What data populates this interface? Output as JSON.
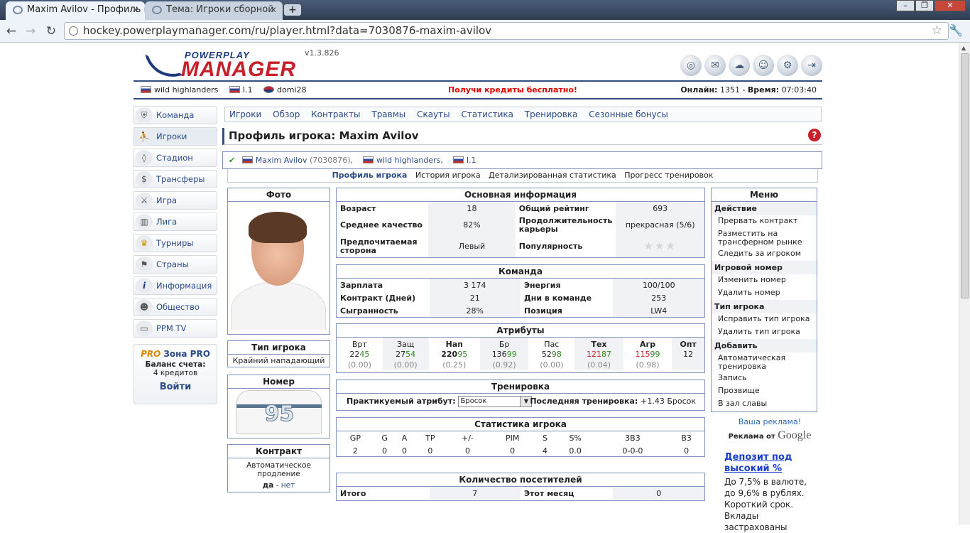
{
  "browser": {
    "tabs": [
      {
        "label": "Maxim Avilov - Профиль и"
      },
      {
        "label": "Тема: Игроки сборной"
      }
    ],
    "url": "hockey.powerplaymanager.com/ru/player.html?data=7030876-maxim-avilov"
  },
  "header": {
    "logo_top": "POWERPLAY",
    "logo_main": "MANAGER",
    "version": "v1.3.826",
    "team": "wild highlanders",
    "league": "I.1",
    "user": "domi28",
    "promo": "Получи кредиты бесплатно!",
    "online_label": "Онлайн:",
    "online": "1351",
    "time_label": "Время:",
    "time": "07:03:40"
  },
  "nav": {
    "items": [
      "Команда",
      "Игроки",
      "Стадион",
      "Трансферы",
      "Игра",
      "Лига",
      "Турниры",
      "Страны",
      "Информация",
      "Общество",
      "PPM TV"
    ],
    "pro_badge": "PRO",
    "pro_title": "Зона PRO",
    "balance_label": "Баланс счета:",
    "balance": "4 кредитов",
    "login": "Войти"
  },
  "tabs": [
    "Игроки",
    "Обзор",
    "Контракты",
    "Травмы",
    "Скауты",
    "Статистика",
    "Тренировка",
    "Сезонные бонусы"
  ],
  "title": "Профиль игрока: Maxim Avilov",
  "player_bar": {
    "name": "Maxim Avilov",
    "id": "(7030876)",
    "team": "wild highlanders",
    "league": "I.1"
  },
  "subtabs": [
    "Профиль игрока",
    "История игрока",
    "Детализированная статистика",
    "Прогресс тренировок"
  ],
  "photo": {
    "title": "Фото"
  },
  "type": {
    "title": "Тип игрока",
    "value": "Крайний нападающий"
  },
  "number": {
    "title": "Номер",
    "value": "95"
  },
  "contract": {
    "title": "Контракт",
    "auto": "Автоматическое продление",
    "yes": "да",
    "sep": "-",
    "no": "нет"
  },
  "basic": {
    "title": "Основная информация",
    "rows": [
      {
        "l1": "Возраст",
        "v1": "18",
        "l2": "Общий рейтинг",
        "v2": "693"
      },
      {
        "l1": "Среднее качество",
        "v1": "82%",
        "l2": "Продолжительность карьеры",
        "v2": "прекрасная (5/6)"
      },
      {
        "l1": "Предпочитаемая сторона",
        "v1": "Левый",
        "l2": "Популярность",
        "v2": ""
      }
    ],
    "popularity_stars": 0
  },
  "team": {
    "title": "Команда",
    "rows": [
      {
        "l1": "Зарплата",
        "v1": "3 174",
        "l2": "Энергия",
        "v2": "100/100"
      },
      {
        "l1": "Контракт (Дней)",
        "v1": "21",
        "l2": "Дни в команде",
        "v2": "253"
      },
      {
        "l1": "Сыгранность",
        "v1": "28%",
        "l2": "Позиция",
        "v2": "LW4"
      }
    ]
  },
  "attributes": {
    "title": "Атрибуты",
    "cols": [
      {
        "h": "Врт",
        "base": "22",
        "q": "45",
        "qc": "g",
        "d": "(0.00)"
      },
      {
        "h": "Защ",
        "base": "27",
        "q": "54",
        "qc": "g",
        "d": "(0.00)"
      },
      {
        "h": "Нап",
        "base": "220",
        "q": "95",
        "qc": "g",
        "d": "(0.25)"
      },
      {
        "h": "Бр",
        "base": "136",
        "q": "99",
        "qc": "g",
        "d": "(0.92)"
      },
      {
        "h": "Пас",
        "base": "52",
        "q": "98",
        "qc": "g",
        "d": "(0.00)"
      },
      {
        "h": "Тех",
        "base": "121",
        "q": "87",
        "qc": "g",
        "d": "(0.04)"
      },
      {
        "h": "Агр",
        "base": "115",
        "q": "99",
        "qc": "g",
        "d": "(0.98)"
      },
      {
        "h": "Опт",
        "base": "12",
        "q": "",
        "qc": "",
        "d": ""
      }
    ]
  },
  "training": {
    "title": "Тренировка",
    "practiced_label": "Практикуемый атрибут:",
    "practiced": "Бросок",
    "last_label": "Последняя тренировка:",
    "last": "+1.43 Бросок"
  },
  "stats": {
    "title": "Статистика игрока",
    "headers": [
      "GP",
      "G",
      "A",
      "TP",
      "+/-",
      "PIM",
      "S",
      "S%",
      "3B3",
      "B3"
    ],
    "values": [
      "2",
      "0",
      "0",
      "0",
      "0",
      "0",
      "4",
      "0.0",
      "0-0-0",
      "0"
    ]
  },
  "visitors": {
    "title": "Количество посетителей",
    "l1": "Итого",
    "v1": "7",
    "l2": "Этот месяц",
    "v2": "0"
  },
  "menu": {
    "title": "Меню",
    "sections": [
      {
        "name": "Действие",
        "items": [
          "Прервать контракт",
          "Разместить на трансферном рынке",
          "Следить за игроком"
        ]
      },
      {
        "name": "Игровой номер",
        "items": [
          "Изменить номер",
          "Удалить номер"
        ]
      },
      {
        "name": "Тип игрока",
        "items": [
          "Исправить тип игрока",
          "Удалить тип игрока"
        ]
      },
      {
        "name": "Добавить",
        "items": [
          "Автоматическая тренировка",
          "Запись",
          "Прозвище",
          "В зал славы"
        ]
      }
    ]
  },
  "ads": {
    "your_ad": "Ваша реклама!",
    "by": "Реклама от",
    "brand": "Google",
    "headline": "Депозит под высокий %",
    "text": "До 7,5% в валюте, до 9,6% в рублях. Короткий срок. Вклады застрахованы"
  }
}
